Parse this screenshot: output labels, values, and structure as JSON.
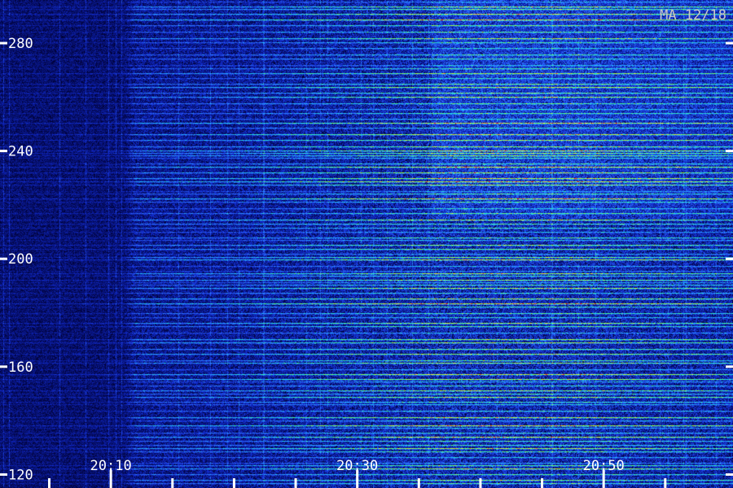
{
  "chart_data": {
    "type": "heatmap",
    "title": "",
    "station_label": "MA 12/18",
    "xlabel": "",
    "ylabel": "",
    "x_tick_labels": [
      "20:10",
      "20:30",
      "20:50"
    ],
    "x_ticks_minutes": [
      10,
      30,
      50
    ],
    "x_minor_ticks_minutes": [
      5,
      10,
      15,
      20,
      25,
      30,
      35,
      40,
      45,
      50,
      55
    ],
    "xlim_minutes": [
      1,
      60.5
    ],
    "y_ticks": [
      120,
      160,
      200,
      240,
      280
    ],
    "ylim": [
      115,
      296
    ],
    "grid": false,
    "colormap": [
      "#000032",
      "#1028c8",
      "#2f6bff",
      "#1ec8ff",
      "#3cff9c",
      "#a0ff3c",
      "#ffff30",
      "#ff2a00"
    ],
    "activity_profile": [
      {
        "t": 1,
        "level": 0.08
      },
      {
        "t": 11,
        "level": 0.1
      },
      {
        "t": 12,
        "level": 0.35
      },
      {
        "t": 20,
        "level": 0.4
      },
      {
        "t": 26,
        "level": 0.55
      },
      {
        "t": 31,
        "level": 0.65
      },
      {
        "t": 37,
        "level": 0.8
      },
      {
        "t": 48,
        "level": 0.8
      },
      {
        "t": 50,
        "level": 0.75
      },
      {
        "t": 60.5,
        "level": 0.6
      }
    ]
  }
}
